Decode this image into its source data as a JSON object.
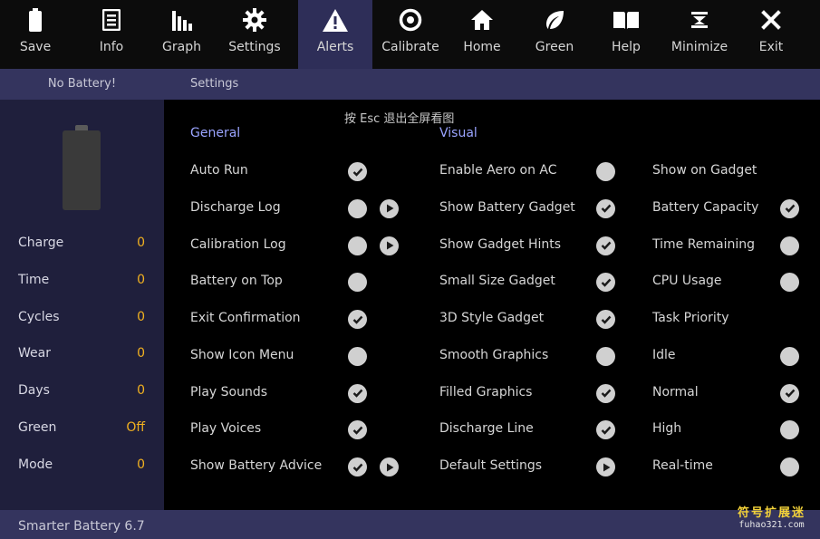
{
  "toolbar": {
    "buttons": [
      {
        "label": "Save",
        "icon": "battery-icon"
      },
      {
        "label": "Info",
        "icon": "document-icon"
      },
      {
        "label": "Graph",
        "icon": "bar-chart-icon"
      },
      {
        "label": "Settings",
        "icon": "gear-icon"
      },
      {
        "label": "Alerts",
        "icon": "warning-icon"
      },
      {
        "label": "Calibrate",
        "icon": "target-icon"
      },
      {
        "label": "Home",
        "icon": "home-icon"
      },
      {
        "label": "Green",
        "icon": "leaf-icon"
      },
      {
        "label": "Help",
        "icon": "book-icon"
      },
      {
        "label": "Minimize",
        "icon": "hourglass-icon"
      },
      {
        "label": "Exit",
        "icon": "close-icon"
      }
    ],
    "active": "Alerts"
  },
  "header": {
    "status": "No Battery!",
    "title": "Settings"
  },
  "esc_hint": "按 Esc 退出全屏看图",
  "left_stats": [
    {
      "label": "Charge",
      "value": "0"
    },
    {
      "label": "Time",
      "value": "0"
    },
    {
      "label": "Cycles",
      "value": "0"
    },
    {
      "label": "Wear",
      "value": "0"
    },
    {
      "label": "Days",
      "value": "0"
    },
    {
      "label": "Green",
      "value": "Off"
    },
    {
      "label": "Mode",
      "value": "0"
    }
  ],
  "general": {
    "heading": "General",
    "items": [
      {
        "label": "Auto Run",
        "checked": true,
        "play": false
      },
      {
        "label": "Discharge Log",
        "checked": false,
        "play": true
      },
      {
        "label": "Calibration Log",
        "checked": false,
        "play": true
      },
      {
        "label": "Battery on Top",
        "checked": false,
        "play": false
      },
      {
        "label": "Exit Confirmation",
        "checked": true,
        "play": false
      },
      {
        "label": "Show Icon Menu",
        "checked": false,
        "play": false
      },
      {
        "label": "Play Sounds",
        "checked": true,
        "play": false
      },
      {
        "label": "Play Voices",
        "checked": true,
        "play": false
      },
      {
        "label": "Show Battery Advice",
        "checked": true,
        "play": true
      }
    ]
  },
  "visual": {
    "heading": "Visual",
    "items": [
      {
        "label": "Enable Aero on AC",
        "checked": false,
        "play": false
      },
      {
        "label": "Show Battery Gadget",
        "checked": true,
        "play": false
      },
      {
        "label": "Show Gadget Hints",
        "checked": true,
        "play": false
      },
      {
        "label": "Small Size Gadget",
        "checked": true,
        "play": false
      },
      {
        "label": "3D Style Gadget",
        "checked": true,
        "play": false
      },
      {
        "label": "Smooth Graphics",
        "checked": false,
        "play": false
      },
      {
        "label": "Filled Graphics",
        "checked": true,
        "play": false
      },
      {
        "label": "Discharge Line",
        "checked": true,
        "play": false
      },
      {
        "label": "Default Settings",
        "checked": null,
        "play": true
      }
    ]
  },
  "gadget": {
    "items": [
      {
        "label": "Show on Gadget",
        "checked": null
      },
      {
        "label": "Battery Capacity",
        "checked": true
      },
      {
        "label": "Time Remaining",
        "checked": false
      },
      {
        "label": "CPU Usage",
        "checked": false
      },
      {
        "label": "Task Priority",
        "checked": null
      },
      {
        "label": "Idle",
        "checked": false
      },
      {
        "label": "Normal",
        "checked": true
      },
      {
        "label": "High",
        "checked": false
      },
      {
        "label": "Real-time",
        "checked": false
      }
    ]
  },
  "footer": {
    "version": "Smarter Battery 6.7",
    "watermark_cn": "符号扩展迷",
    "watermark_url": "fuhao321.com"
  },
  "colors": {
    "toolbar_bg": "#0c0c0c",
    "active_tab": "#2e2e58",
    "header_bg": "#34345e",
    "left_panel": "#1f1f3c",
    "stat_value": "#f0b020",
    "section_heading": "#9aa4ff"
  }
}
